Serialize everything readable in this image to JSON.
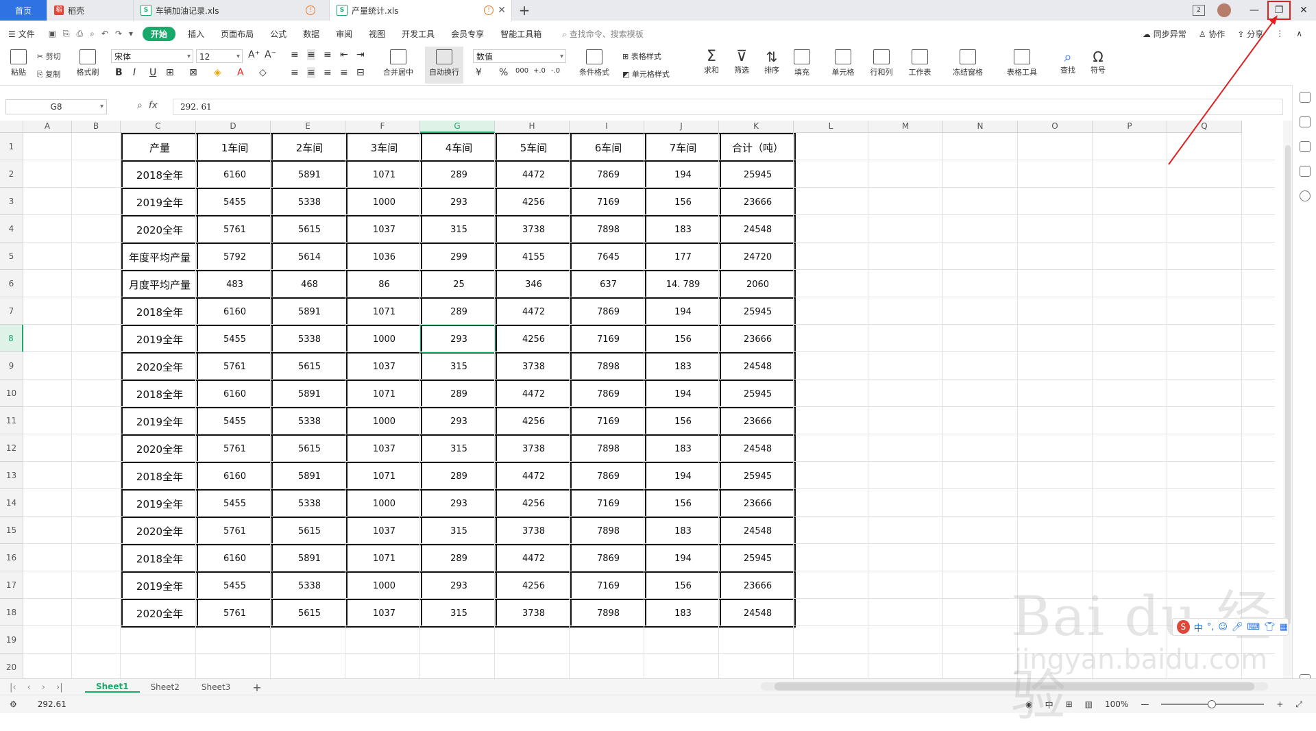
{
  "tabs": {
    "home": "首页",
    "docer": "稻壳",
    "file1": "车辆加油记录.xls",
    "file2": "产量统计.xls"
  },
  "menu": {
    "file": "文件",
    "items": [
      "开始",
      "插入",
      "页面布局",
      "公式",
      "数据",
      "审阅",
      "视图",
      "开发工具",
      "会员专享",
      "智能工具箱"
    ],
    "search": "查找命令、搜索模板",
    "sync": "同步异常",
    "collab": "协作",
    "share": "分享"
  },
  "ribbon": {
    "paste": "粘贴",
    "cut": "剪切",
    "copy": "复制",
    "format_painter": "格式刷",
    "font": "宋体",
    "size": "12",
    "merge": "合并居中",
    "wrap": "自动换行",
    "numfmt": "数值",
    "table_style": "表格样式",
    "cond_fmt": "条件格式",
    "cell_style": "单元格样式",
    "sum": "求和",
    "filter": "筛选",
    "sort": "排序",
    "fill": "填充",
    "cell": "单元格",
    "rowcol": "行和列",
    "sheet": "工作表",
    "freeze": "冻结窗格",
    "table_tools": "表格工具",
    "find": "查找",
    "symbol": "符号"
  },
  "formula": {
    "namebox": "G8",
    "value": "292. 61"
  },
  "columns": [
    "A",
    "B",
    "C",
    "D",
    "E",
    "F",
    "G",
    "H",
    "I",
    "J",
    "K",
    "L",
    "M",
    "N",
    "O",
    "P",
    "Q"
  ],
  "rows": [
    "1",
    "2",
    "3",
    "4",
    "5",
    "6",
    "7",
    "8",
    "9",
    "10",
    "11",
    "12",
    "13",
    "14",
    "15",
    "16",
    "17",
    "18",
    "19",
    "20"
  ],
  "table": {
    "headers": [
      "产量",
      "1车间",
      "2车间",
      "3车间",
      "4车间",
      "5车间",
      "6车间",
      "7车间",
      "合计（吨）"
    ],
    "rows": [
      [
        "2018全年",
        "6160",
        "5891",
        "1071",
        "289",
        "4472",
        "7869",
        "194",
        "25945"
      ],
      [
        "2019全年",
        "5455",
        "5338",
        "1000",
        "293",
        "4256",
        "7169",
        "156",
        "23666"
      ],
      [
        "2020全年",
        "5761",
        "5615",
        "1037",
        "315",
        "3738",
        "7898",
        "183",
        "24548"
      ],
      [
        "年度平均产量",
        "5792",
        "5614",
        "1036",
        "299",
        "4155",
        "7645",
        "177",
        "24720"
      ],
      [
        "月度平均产量",
        "483",
        "468",
        "86",
        "25",
        "346",
        "637",
        "14. 789",
        "2060"
      ],
      [
        "2018全年",
        "6160",
        "5891",
        "1071",
        "289",
        "4472",
        "7869",
        "194",
        "25945"
      ],
      [
        "2019全年",
        "5455",
        "5338",
        "1000",
        "293",
        "4256",
        "7169",
        "156",
        "23666"
      ],
      [
        "2020全年",
        "5761",
        "5615",
        "1037",
        "315",
        "3738",
        "7898",
        "183",
        "24548"
      ],
      [
        "2018全年",
        "6160",
        "5891",
        "1071",
        "289",
        "4472",
        "7869",
        "194",
        "25945"
      ],
      [
        "2019全年",
        "5455",
        "5338",
        "1000",
        "293",
        "4256",
        "7169",
        "156",
        "23666"
      ],
      [
        "2020全年",
        "5761",
        "5615",
        "1037",
        "315",
        "3738",
        "7898",
        "183",
        "24548"
      ],
      [
        "2018全年",
        "6160",
        "5891",
        "1071",
        "289",
        "4472",
        "7869",
        "194",
        "25945"
      ],
      [
        "2019全年",
        "5455",
        "5338",
        "1000",
        "293",
        "4256",
        "7169",
        "156",
        "23666"
      ],
      [
        "2020全年",
        "5761",
        "5615",
        "1037",
        "315",
        "3738",
        "7898",
        "183",
        "24548"
      ],
      [
        "2018全年",
        "6160",
        "5891",
        "1071",
        "289",
        "4472",
        "7869",
        "194",
        "25945"
      ],
      [
        "2019全年",
        "5455",
        "5338",
        "1000",
        "293",
        "4256",
        "7169",
        "156",
        "23666"
      ],
      [
        "2020全年",
        "5761",
        "5615",
        "1037",
        "315",
        "3738",
        "7898",
        "183",
        "24548"
      ]
    ]
  },
  "sheets": [
    "Sheet1",
    "Sheet2",
    "Sheet3"
  ],
  "status": {
    "value": "292.61",
    "zoom": "100%"
  },
  "watermark": {
    "line1": "Bai du 经验",
    "line2": "jingyan.baidu.com"
  },
  "colors": {
    "accent": "#1aa96b",
    "tab_home": "#2f73e3",
    "annotation": "#e02020"
  }
}
